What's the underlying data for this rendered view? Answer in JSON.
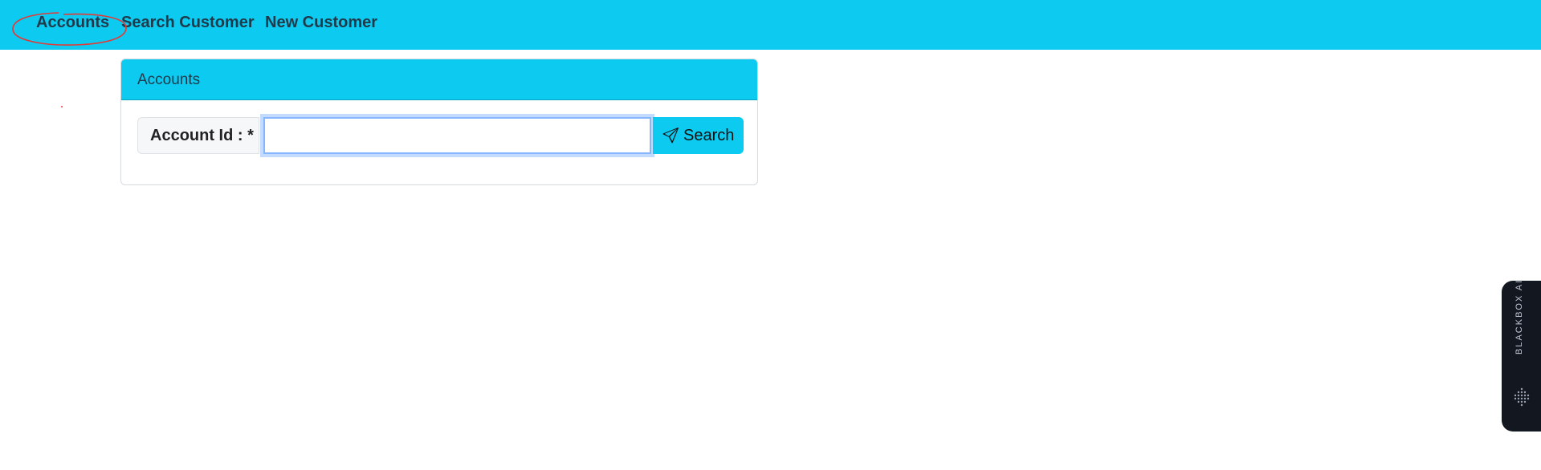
{
  "navbar": {
    "links": [
      {
        "label": "Accounts"
      },
      {
        "label": "Search Customer"
      },
      {
        "label": "New Customer"
      }
    ],
    "background": "#0dcaf0"
  },
  "card": {
    "title": "Accounts",
    "form": {
      "label": "Account Id : *",
      "input_value": "",
      "input_placeholder": "",
      "search_button_label": "Search",
      "search_button_icon": "paper-plane-icon"
    }
  },
  "side_widget": {
    "label": "BLACKBOX AI",
    "icon": "blackbox-logo-icon"
  },
  "colors": {
    "accent": "#0dcaf0",
    "annotation": "#e53935",
    "focus_border": "#86b7fe"
  }
}
